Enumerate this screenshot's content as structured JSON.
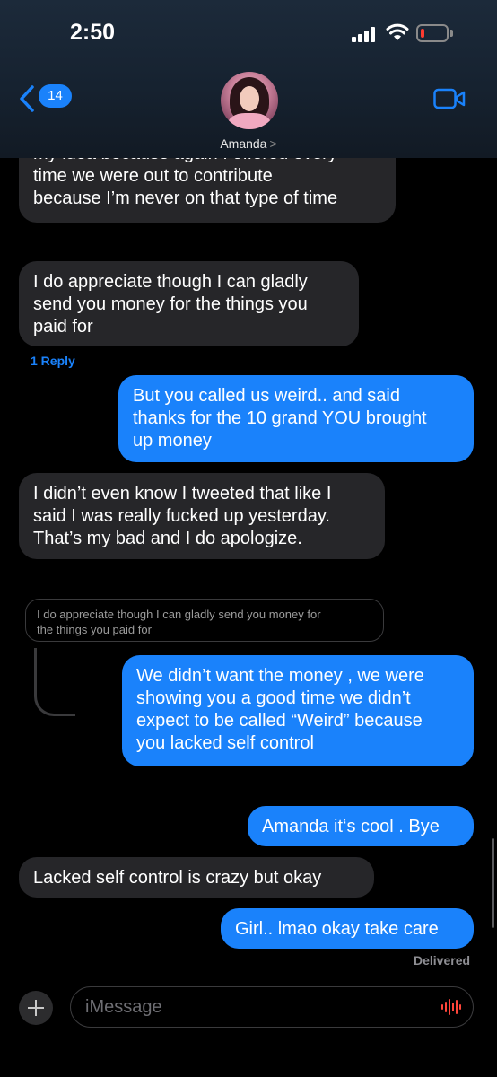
{
  "status_bar": {
    "time": "2:50"
  },
  "nav": {
    "back_count": "14",
    "contact_name": "Amanda",
    "contact_chevron": ">"
  },
  "messages": [
    {
      "direction": "in",
      "lines": [
        "my idea because again I offered every",
        "time we were out to contribute",
        "because I’m never on that type of time"
      ]
    },
    {
      "direction": "in",
      "lines": [
        "I do appreciate though I can gladly",
        "send you money for the things you",
        "paid for"
      ]
    },
    {
      "direction": "out",
      "lines": [
        "But you called us weird.. and said",
        "thanks for the 10 grand YOU brought",
        "up money"
      ]
    },
    {
      "direction": "in",
      "lines": [
        "I didn’t even know I tweeted that like I",
        "said I was really fucked up yesterday.",
        "That’s my bad and I do apologize."
      ]
    },
    {
      "direction": "out",
      "lines": [
        "We didn’t want the money , we were",
        "showing you a good time we didn’t",
        "expect to be called “Weird” because",
        "you lacked self control"
      ]
    },
    {
      "direction": "out",
      "lines": [
        "Amanda it‘s cool . Bye"
      ]
    },
    {
      "direction": "in",
      "lines": [
        "Lacked self control is crazy but okay"
      ]
    },
    {
      "direction": "out",
      "lines": [
        "Girl.. lmao okay take care"
      ]
    }
  ],
  "reply_link": "1 Reply",
  "quoted_reply": [
    "I do appreciate though I can gladly send you money for",
    "the things you paid for"
  ],
  "delivered": "Delivered",
  "compose": {
    "placeholder": "iMessage"
  },
  "colors": {
    "outgoing_bubble": "#1a82fb",
    "incoming_bubble": "#262629",
    "background": "#000000",
    "battery_low": "#ff3b30"
  },
  "icons": {
    "back": "chevron-left-icon",
    "video": "video-camera-icon",
    "add": "plus-icon",
    "audio": "waveform-icon"
  }
}
